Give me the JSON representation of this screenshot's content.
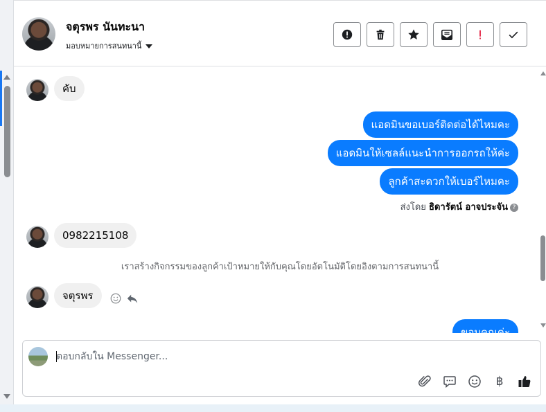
{
  "header": {
    "name": "จตุรพร นันทะนา",
    "assign_label": "มอบหมายการสนทนานี้"
  },
  "chat": {
    "messages_in_1": "คับ",
    "messages_out": [
      "แอดมินขอเบอร์ติดต่อได้ไหมคะ",
      "แอดมินให้เซลล์แนะนำการออกรถให้ค่ะ",
      "ลูกค้าสะดวกให้เบอร์ไหมคะ"
    ],
    "sent_by_prefix": "ส่งโดย",
    "sent_by_name": "ธิดารัตน์ อาจประจัน",
    "messages_in_2": "0982215108",
    "system_note": "เราสร้างกิจกรรมของลูกค้าเป้าหมายให้กับคุณโดยอัตโนมัติโดยอิงตามการสนทนานี้",
    "messages_in_3": "จตุรพร",
    "messages_out_partial": "ขอบคุณค่ะ"
  },
  "composer": {
    "placeholder": "ตอบกลับใน Messenger..."
  },
  "colors": {
    "accent": "#0a7cff",
    "incoming_bubble": "#f0f0f0"
  },
  "icons": {
    "header_actions": [
      "report-icon",
      "trash-icon",
      "star-icon",
      "mark-unread-icon",
      "priority-icon",
      "done-check-icon"
    ],
    "composer_tools": [
      "paperclip-icon",
      "saved-reply-icon",
      "emoji-icon",
      "baht-payment-icon",
      "thumbs-up-icon"
    ]
  }
}
